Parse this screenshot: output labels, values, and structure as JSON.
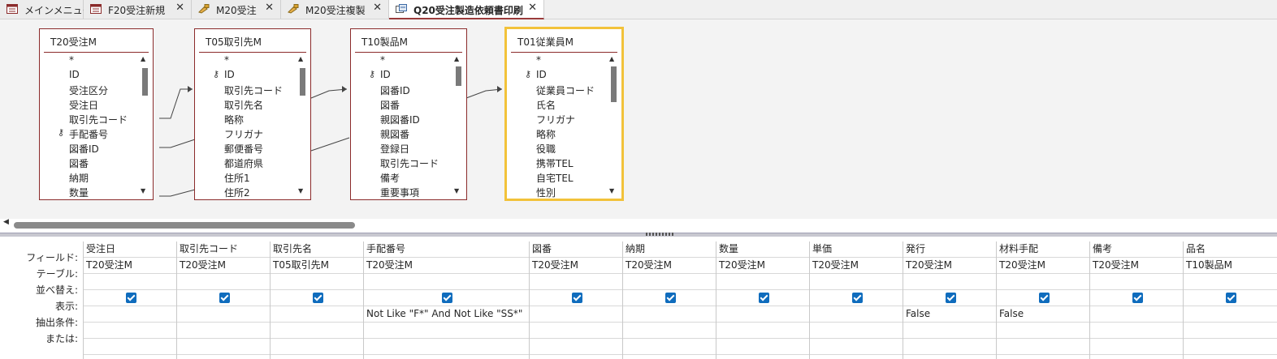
{
  "tabs": [
    {
      "label": "メインメニュー",
      "icon": "form-icon",
      "closable": false
    },
    {
      "label": "F20受注新規",
      "icon": "form-icon",
      "closable": true
    },
    {
      "label": "M20受注",
      "icon": "macro-icon",
      "closable": true
    },
    {
      "label": "M20受注複製",
      "icon": "macro-icon",
      "closable": true
    },
    {
      "label": "Q20受注製造依頼書印刷",
      "icon": "query-icon",
      "closable": true,
      "active": true
    }
  ],
  "close_glyph": "✕",
  "tables": [
    {
      "title": "T20受注M",
      "fields": [
        "*",
        "ID",
        "受注区分",
        "受注日",
        "取引先コード",
        "手配番号",
        "図番ID",
        "図番",
        "納期",
        "数量"
      ],
      "key_index": 5
    },
    {
      "title": "T05取引先M",
      "fields": [
        "*",
        "ID",
        "取引先コード",
        "取引先名",
        "略称",
        "フリガナ",
        "郵便番号",
        "都道府県",
        "住所1",
        "住所2"
      ],
      "key_index": 1
    },
    {
      "title": "T10製品M",
      "fields": [
        "*",
        "ID",
        "図番ID",
        "図番",
        "親図番ID",
        "親図番",
        "登録日",
        "取引先コード",
        "備考",
        "重要事項"
      ],
      "key_index": 1
    },
    {
      "title": "T01従業員M",
      "fields": [
        "*",
        "ID",
        "従業員コード",
        "氏名",
        "フリガナ",
        "略称",
        "役職",
        "携帯TEL",
        "自宅TEL",
        "性別"
      ],
      "key_index": 1,
      "selected": true
    }
  ],
  "grid": {
    "row_labels": [
      "フィールド:",
      "テーブル:",
      "並べ替え:",
      "表示:",
      "抽出条件:",
      "または:"
    ],
    "columns": [
      {
        "field": "受注日",
        "table": "T20受注M",
        "show": true,
        "criteria": ""
      },
      {
        "field": "取引先コード",
        "table": "T20受注M",
        "show": true,
        "criteria": ""
      },
      {
        "field": "取引先名",
        "table": "T05取引先M",
        "show": true,
        "criteria": ""
      },
      {
        "field": "手配番号",
        "table": "T20受注M",
        "show": true,
        "criteria": "Not Like \"F*\" And Not Like \"SS*\""
      },
      {
        "field": "図番",
        "table": "T20受注M",
        "show": true,
        "criteria": ""
      },
      {
        "field": "納期",
        "table": "T20受注M",
        "show": true,
        "criteria": ""
      },
      {
        "field": "数量",
        "table": "T20受注M",
        "show": true,
        "criteria": ""
      },
      {
        "field": "単価",
        "table": "T20受注M",
        "show": true,
        "criteria": ""
      },
      {
        "field": "発行",
        "table": "T20受注M",
        "show": true,
        "criteria": "False"
      },
      {
        "field": "材料手配",
        "table": "T20受注M",
        "show": true,
        "criteria": "False"
      },
      {
        "field": "備考",
        "table": "T20受注M",
        "show": true,
        "criteria": ""
      },
      {
        "field": "品名",
        "table": "T10製品M",
        "show": true,
        "criteria": ""
      }
    ]
  },
  "colors": {
    "accent": "#9a3b3b",
    "table_border": "#8b2b2b",
    "selected_table": "#f2c23a",
    "checkbox": "#0f6cbd"
  }
}
